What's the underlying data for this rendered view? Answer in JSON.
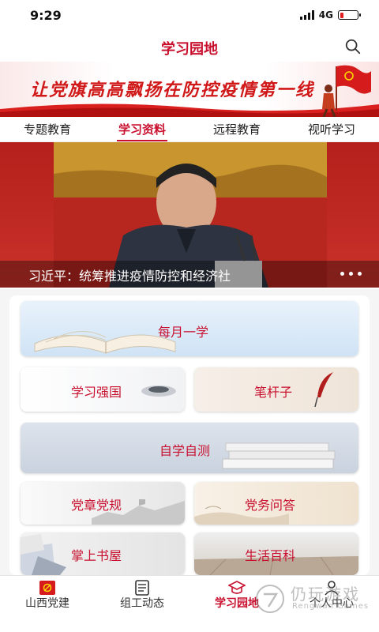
{
  "status_bar": {
    "time": "9:29",
    "network": "4G"
  },
  "header": {
    "title": "学习园地",
    "search_icon": "search-icon"
  },
  "banner": {
    "slogan": "让党旗高高飘扬在防控疫情第一线"
  },
  "tabs": [
    {
      "label": "专题教育",
      "active": false
    },
    {
      "label": "学习资料",
      "active": true
    },
    {
      "label": "远程教育",
      "active": false
    },
    {
      "label": "视听学习",
      "active": false
    }
  ],
  "carousel": {
    "caption": "习近平：统筹推进疫情防控和经济社",
    "dots": 3
  },
  "cards": {
    "monthly": "每月一学",
    "xxqg": "学习强国",
    "bgz": "笔杆子",
    "self_test": "自学自测",
    "dzdg": "党章党规",
    "dwwd": "党务问答",
    "zssw": "掌上书屋",
    "shbk": "生活百科"
  },
  "bottom_nav": [
    {
      "label": "山西党建",
      "icon": "party-emblem-icon",
      "active": false
    },
    {
      "label": "组工动态",
      "icon": "news-icon",
      "active": false
    },
    {
      "label": "学习园地",
      "icon": "graduation-cap-icon",
      "active": true
    },
    {
      "label": "个人中心",
      "icon": "user-icon",
      "active": false
    }
  ],
  "watermark": {
    "cn": "仍玩游戏",
    "en": "Rengwan Games"
  },
  "colors": {
    "primary": "#c8102e",
    "text": "#222222"
  }
}
